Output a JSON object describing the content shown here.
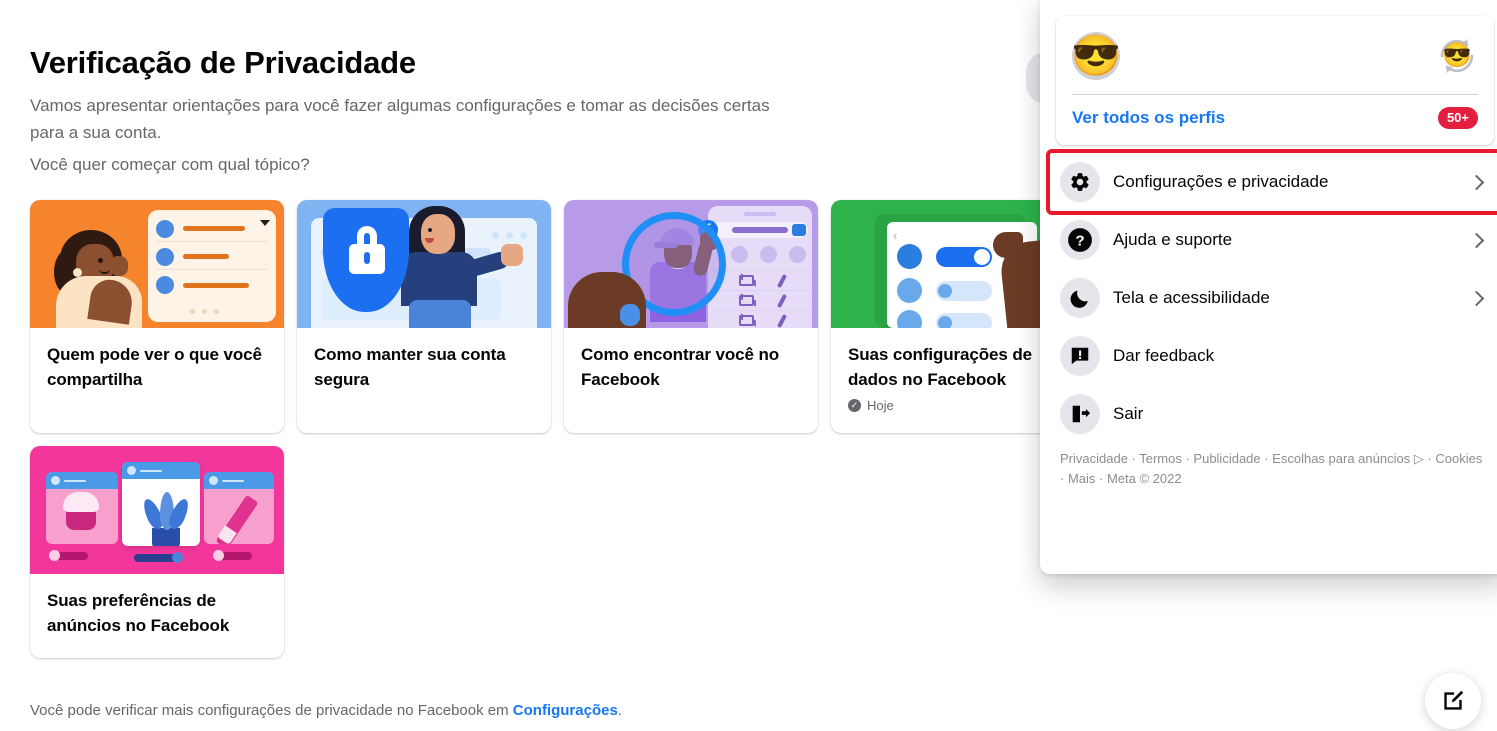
{
  "main": {
    "title": "Verificação de Privacidade",
    "subtitle_line1": "Vamos apresentar orientações para você fazer algumas configurações e tomar as decisões certas",
    "subtitle_line2": "para a sua conta.",
    "question": "Você quer começar com qual tópico?",
    "footnote_text": "Você pode verificar mais configurações de privacidade no Facebook em ",
    "footnote_link": "Configurações",
    "footnote_end": ".",
    "cards": [
      {
        "title": "Quem pode ver o que você compartilha",
        "meta": "",
        "art": "orange"
      },
      {
        "title": "Como manter sua conta segura",
        "meta": "",
        "art": "blue"
      },
      {
        "title": "Como encontrar você no Facebook",
        "meta": "",
        "art": "purple"
      },
      {
        "title": "Suas configurações de dados no Facebook",
        "meta": "Hoje",
        "art": "green"
      },
      {
        "title": "Suas preferências de anúncios no Facebook",
        "meta": "",
        "art": "pink"
      }
    ]
  },
  "menu": {
    "profile": {
      "avatar_emoji": "😎",
      "switch_emoji": "😎",
      "see_all_label": "Ver todos os perfis",
      "badge": "50+"
    },
    "items": [
      {
        "label": "Configurações e privacidade",
        "icon": "gear-icon",
        "chevron": true,
        "highlighted": true
      },
      {
        "label": "Ajuda e suporte",
        "icon": "question-mark-icon",
        "chevron": true,
        "highlighted": false
      },
      {
        "label": "Tela e acessibilidade",
        "icon": "moon-icon",
        "chevron": true,
        "highlighted": false
      },
      {
        "label": "Dar feedback",
        "icon": "feedback-icon",
        "chevron": false,
        "highlighted": false
      },
      {
        "label": "Sair",
        "icon": "logout-icon",
        "chevron": false,
        "highlighted": false
      }
    ],
    "footer": "Privacidade · Termos · Publicidade · Escolhas para anúncios ▷ · Cookies · Mais · Meta © 2022"
  },
  "fab": {
    "icon": "compose-icon"
  },
  "colors": {
    "accent_blue": "#1877f2",
    "highlight_red": "#e8192c",
    "badge_red": "#e41e3f",
    "text_primary": "#050505",
    "text_secondary": "#65676b"
  }
}
